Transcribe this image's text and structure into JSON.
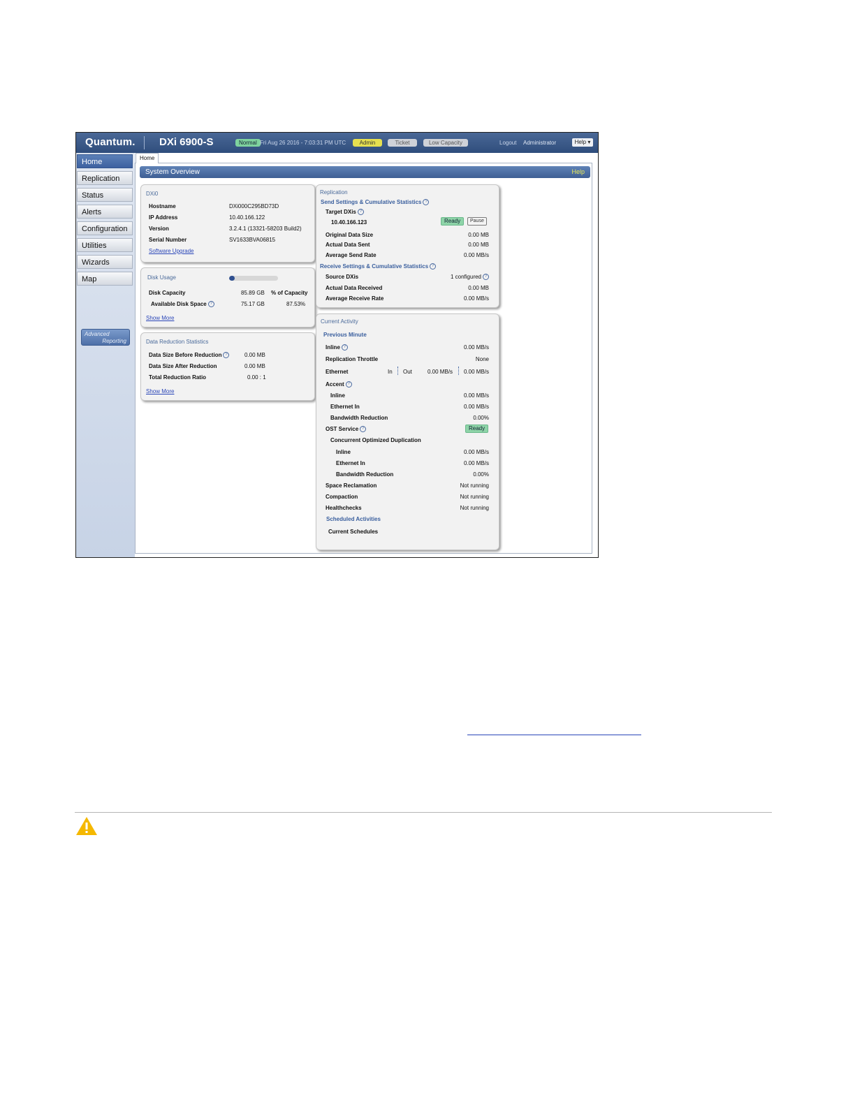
{
  "header": {
    "brand": "Quantum.",
    "model": "DXi 6900-S",
    "status_badge": "Normal",
    "datetime": "Fri Aug 26 2016 - 7:03:31 PM UTC",
    "role_badge": "Admin",
    "ticket_badge": "Ticket",
    "capacity_badge": "Low Capacity",
    "logout": "Logout",
    "user": "Administrator",
    "help_menu": "Help ▾"
  },
  "sidebar": {
    "items": [
      {
        "label": "Home",
        "active": true
      },
      {
        "label": "Replication"
      },
      {
        "label": "Status"
      },
      {
        "label": "Alerts"
      },
      {
        "label": "Configuration"
      },
      {
        "label": "Utilities"
      },
      {
        "label": "Wizards"
      },
      {
        "label": "Map"
      }
    ],
    "advanced_line1": "Advanced",
    "advanced_line2": "Reporting"
  },
  "tab": "Home",
  "page": {
    "title": "System Overview",
    "help": "Help"
  },
  "dxi": {
    "title": "DXi0",
    "hostname_label": "Hostname",
    "hostname": "DXi000C295BD73D",
    "ip_label": "IP Address",
    "ip": "10.40.166.122",
    "version_label": "Version",
    "version": "3.2.4.1 (13321-58203 Build2)",
    "serial_label": "Serial Number",
    "serial": "SV1633BVA06815",
    "upgrade_link": "Software Upgrade"
  },
  "disk": {
    "title": "Disk Usage",
    "used_fraction": 0.12,
    "capacity_label": "Disk Capacity",
    "capacity": "85.89 GB",
    "pct_header": "% of Capacity",
    "available_label": "Available Disk Space",
    "available": "75.17 GB",
    "available_pct": "87.53%",
    "show_more": "Show More"
  },
  "reduction": {
    "title": "Data Reduction Statistics",
    "before_label": "Data Size Before Reduction",
    "before": "0.00 MB",
    "after_label": "Data Size After Reduction",
    "after": "0.00 MB",
    "ratio_label": "Total Reduction Ratio",
    "ratio": "0.00 : 1",
    "show_more": "Show More"
  },
  "replication": {
    "title": "Replication",
    "send_title": "Send Settings & Cumulative Statistics",
    "target_label": "Target DXis",
    "target_ip": "10.40.166.123",
    "target_status": "Ready",
    "pause_btn": "Pause",
    "orig_label": "Original Data Size",
    "orig": "0.00 MB",
    "sent_label": "Actual Data Sent",
    "sent": "0.00 MB",
    "send_rate_label": "Average Send Rate",
    "send_rate": "0.00 MB/s",
    "receive_title": "Receive Settings & Cumulative Statistics",
    "source_label": "Source DXis",
    "source": "1 configured",
    "received_label": "Actual Data Received",
    "received": "0.00 MB",
    "recv_rate_label": "Average Receive Rate",
    "recv_rate": "0.00 MB/s"
  },
  "activity": {
    "title": "Current Activity",
    "prev_minute": "Previous Minute",
    "inline_label": "Inline",
    "inline": "0.00 MB/s",
    "throttle_label": "Replication Throttle",
    "throttle": "None",
    "ethernet_label": "Ethernet",
    "eth_in_label": "In",
    "eth_out_label": "Out",
    "eth_in": "0.00 MB/s",
    "eth_out": "0.00 MB/s",
    "accent_label": "Accent",
    "accent_inline_label": "Inline",
    "accent_inline": "0.00 MB/s",
    "accent_eth_label": "Ethernet In",
    "accent_eth": "0.00 MB/s",
    "accent_bw_label": "Bandwidth Reduction",
    "accent_bw": "0.00%",
    "ost_label": "OST Service",
    "ost_status": "Ready",
    "cod_label": "Concurrent Optimized Duplication",
    "cod_inline_label": "Inline",
    "cod_inline": "0.00 MB/s",
    "cod_eth_label": "Ethernet In",
    "cod_eth": "0.00 MB/s",
    "cod_bw_label": "Bandwidth Reduction",
    "cod_bw": "0.00%",
    "space_label": "Space Reclamation",
    "space": "Not running",
    "compaction_label": "Compaction",
    "compaction": "Not running",
    "health_label": "Healthchecks",
    "health": "Not running",
    "sched_title": "Scheduled Activities",
    "sched_current": "Current Schedules"
  },
  "colors": {
    "caution": "#f5b800",
    "accent": "#3e5f94"
  },
  "icons": {
    "caution": "caution-icon"
  }
}
